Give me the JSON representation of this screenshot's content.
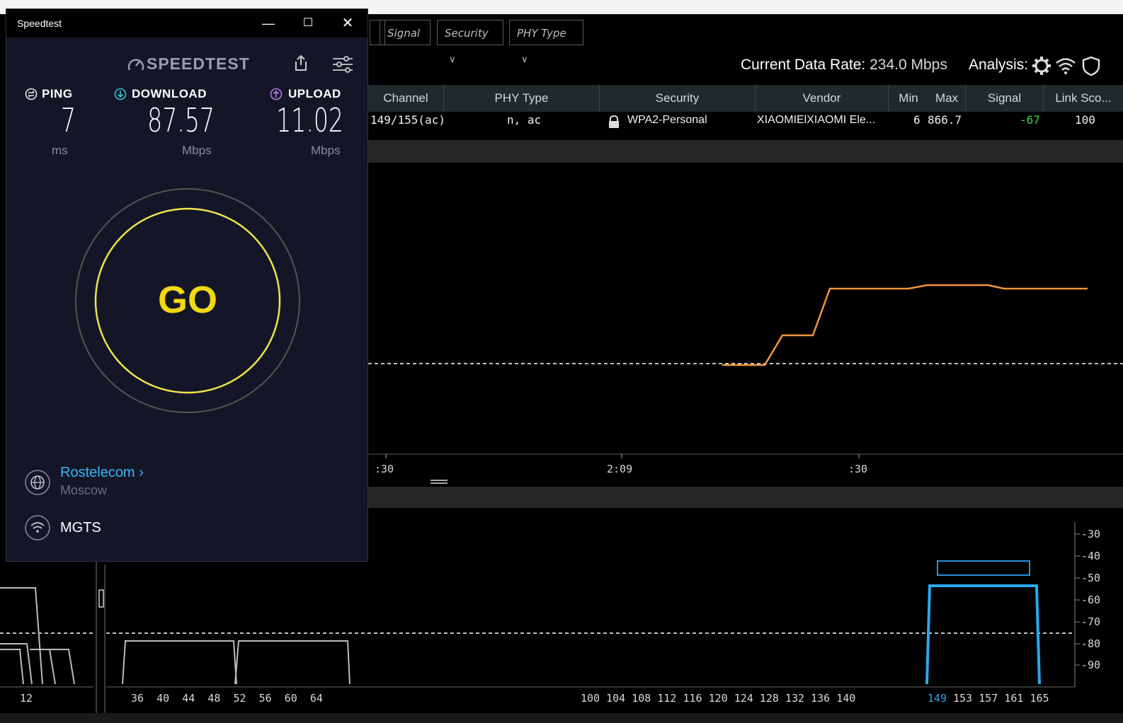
{
  "filters": {
    "signal": "Signal",
    "security": "Security",
    "phy_type": "PHY Type"
  },
  "header": {
    "rate_label": "Current Data Rate:",
    "rate_value": "234.0 Mbps",
    "analysis_label": "Analysis:"
  },
  "table": {
    "columns": [
      "Channel",
      "PHY Type",
      "Security",
      "Vendor",
      "Min",
      "Max",
      "Signal",
      "Link Sco..."
    ],
    "row": {
      "channel": "149/155(ac)",
      "phy": "n, ac",
      "security": "WPA2-Personal",
      "vendor": "XIAOMIElXIAOMI Ele...",
      "min": "6",
      "max": "866.7",
      "signal": "-67",
      "link_score": "100"
    }
  },
  "time_axis": [
    ":30",
    "2:09",
    ":30"
  ],
  "spectrum": {
    "db_labels": [
      "-30",
      "-40",
      "-50",
      "-60",
      "-70",
      "-80",
      "-90"
    ],
    "left_channels": [
      "12"
    ],
    "channels_5ghz_a": [
      "36",
      "40",
      "44",
      "48",
      "52",
      "56",
      "60",
      "64"
    ],
    "channels_5ghz_b": [
      "100",
      "104",
      "108",
      "112",
      "116",
      "120",
      "124",
      "128",
      "132",
      "136",
      "140"
    ],
    "channels_5ghz_c": [
      "149",
      "153",
      "157",
      "161",
      "165"
    ],
    "highlight_channel": "149"
  },
  "speedtest": {
    "window_title": "Speedtest",
    "brand": "SPEEDTEST",
    "ping": {
      "label": "PING",
      "value": "7",
      "unit": "ms"
    },
    "download": {
      "label": "DOWNLOAD",
      "value": "87.57",
      "unit": "Mbps"
    },
    "upload": {
      "label": "UPLOAD",
      "value": "11.02",
      "unit": "Mbps"
    },
    "go_label": "GO",
    "server": {
      "name": "Rostelecom",
      "location": "Moscow"
    },
    "isp": "MGTS"
  },
  "colors": {
    "accent_yellow": "#f2d713",
    "accent_blue": "#35b6f0",
    "orange_line": "#f0963a",
    "signal_green": "#3fd24a",
    "spectrum_blue": "#2aa8ee"
  }
}
